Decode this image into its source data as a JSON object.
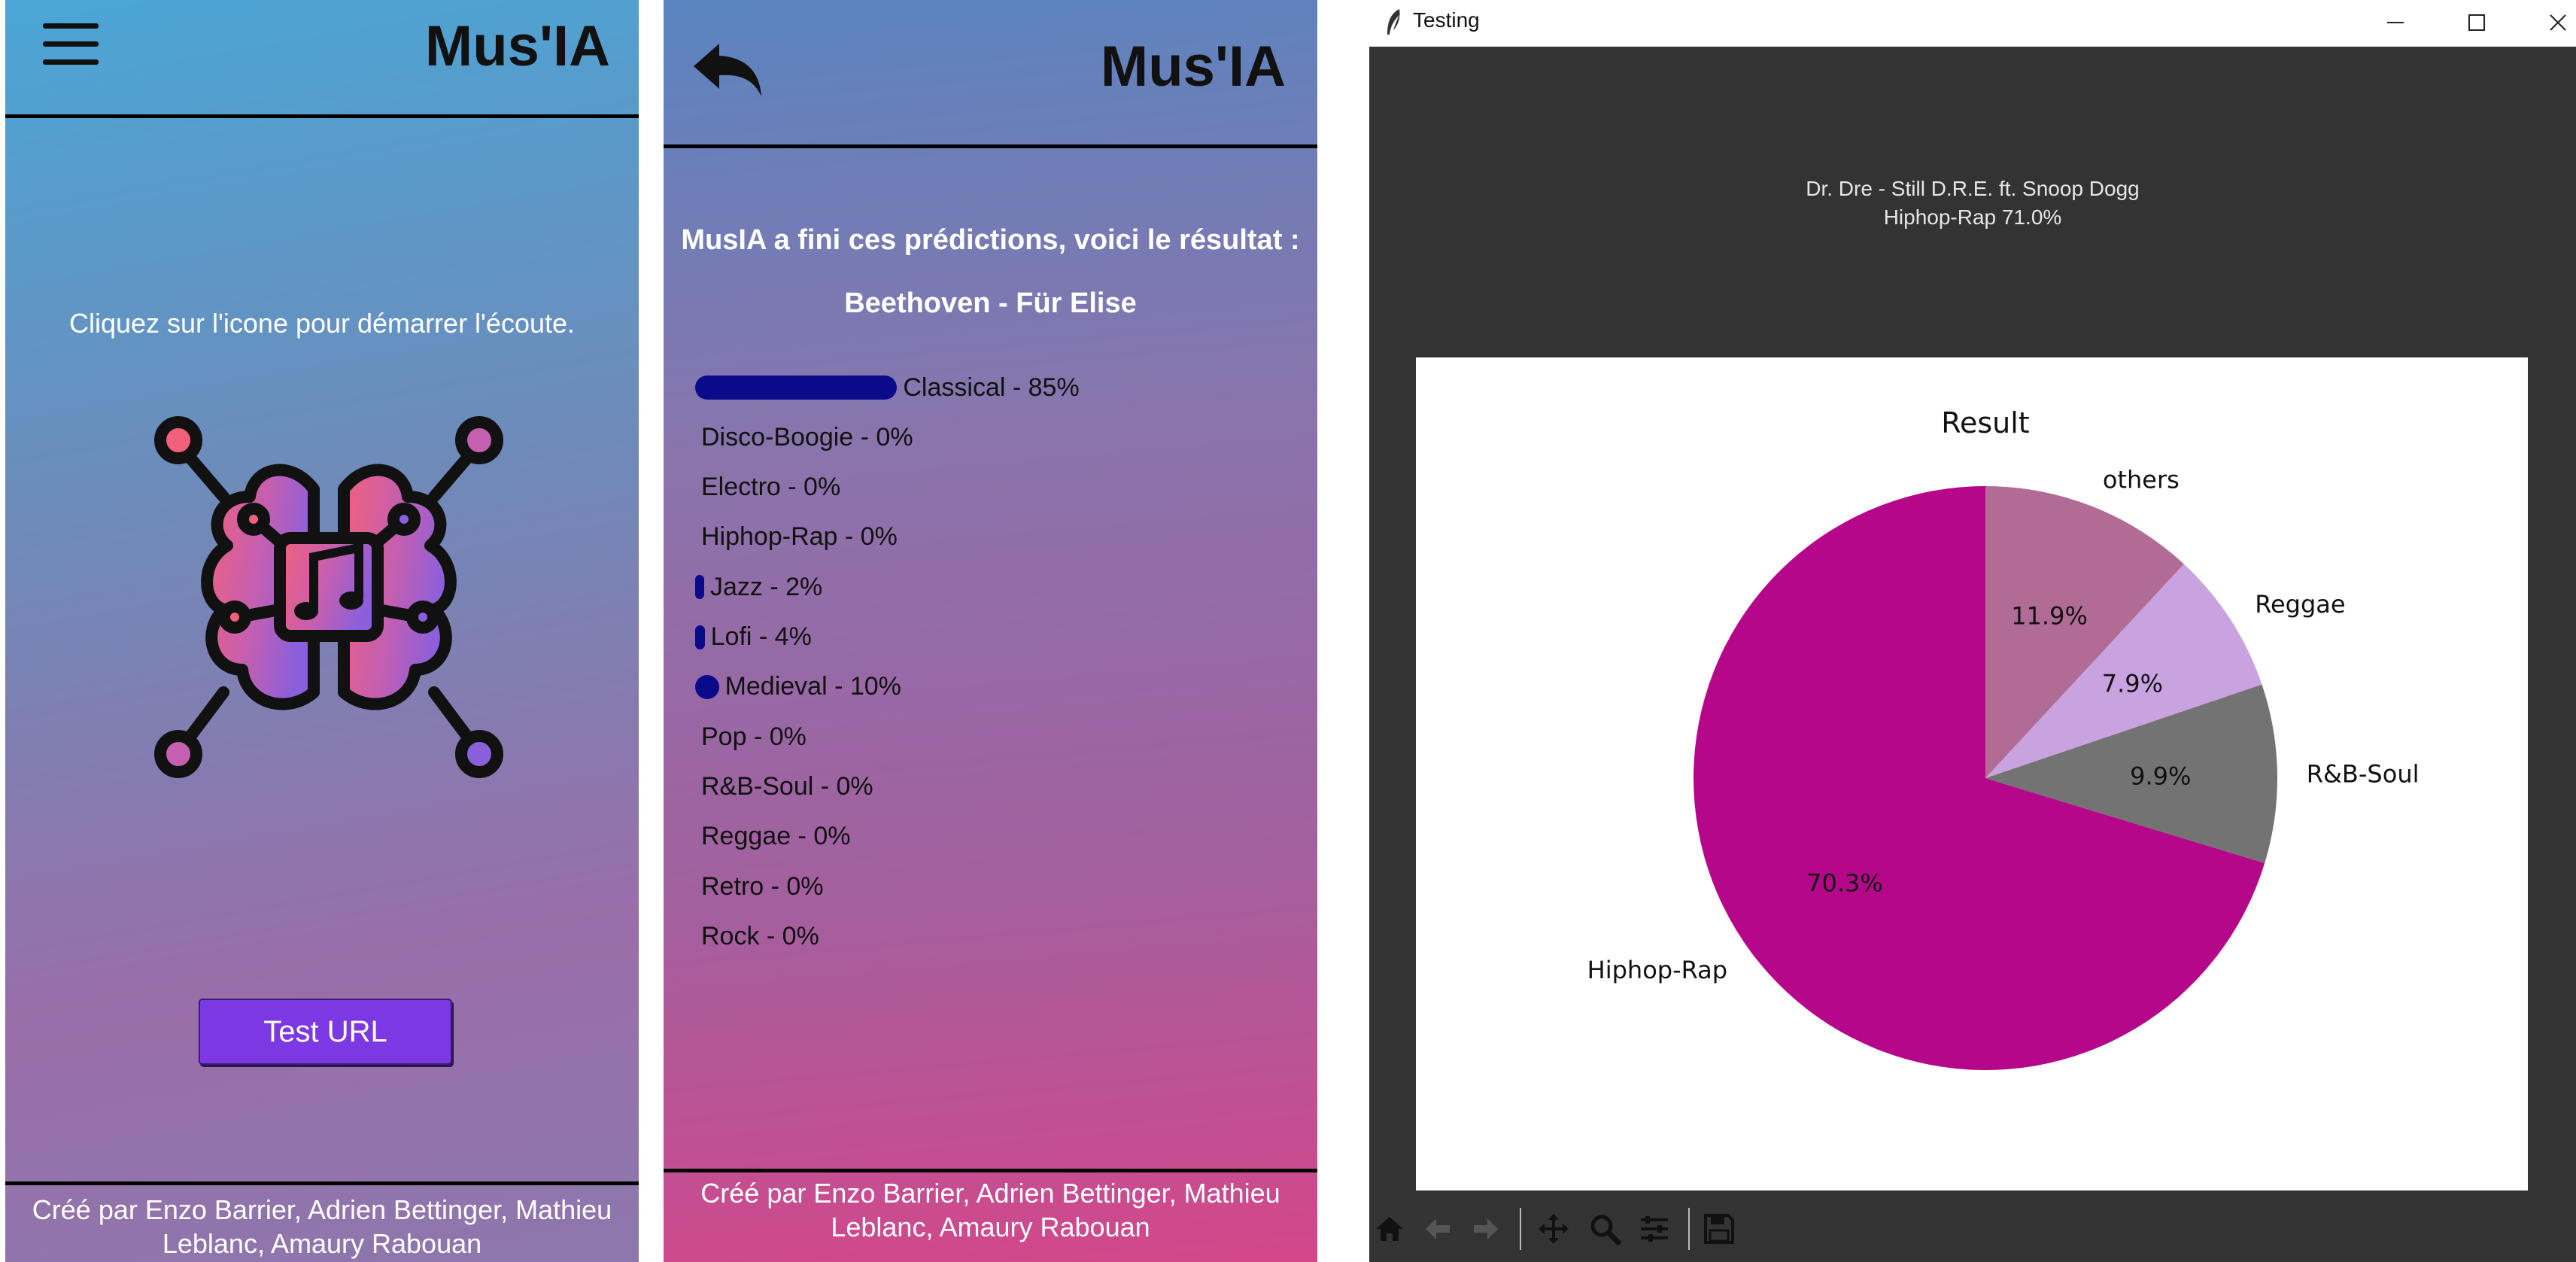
{
  "app1": {
    "title": "Mus'IA",
    "instruction": "Cliquez sur l'icone pour démarrer l'écoute.",
    "button_label": "Test URL",
    "footer": "Créé par Enzo Barrier, Adrien Bettinger, Mathieu Leblanc, Amaury Rabouan"
  },
  "app2": {
    "title": "Mus'IA",
    "result_heading": "MusIA a fini ces prédictions, voici le résultat :",
    "song": "Beethoven - Für Elise",
    "predictions": [
      {
        "genre": "Classical - 85%",
        "value": 85
      },
      {
        "genre": "Disco-Boogie - 0%",
        "value": 0
      },
      {
        "genre": "Electro - 0%",
        "value": 0
      },
      {
        "genre": "Hiphop-Rap - 0%",
        "value": 0
      },
      {
        "genre": "Jazz - 2%",
        "value": 2
      },
      {
        "genre": "Lofi - 4%",
        "value": 4
      },
      {
        "genre": "Medieval - 10%",
        "value": 10
      },
      {
        "genre": "Pop - 0%",
        "value": 0
      },
      {
        "genre": "R&B-Soul - 0%",
        "value": 0
      },
      {
        "genre": "Reggae - 0%",
        "value": 0
      },
      {
        "genre": "Retro - 0%",
        "value": 0
      },
      {
        "genre": "Rock - 0%",
        "value": 0
      }
    ],
    "footer": "Créé par Enzo Barrier, Adrien Bettinger, Mathieu Leblanc, Amaury Rabouan"
  },
  "window": {
    "title": "Testing",
    "song_line": "Dr. Dre - Still D.R.E. ft. Snoop Dogg",
    "result_line": "Hiphop-Rap 71.0%",
    "toolbar_icons": [
      "home-icon",
      "back-arrow-icon",
      "forward-arrow-icon",
      "pan-icon",
      "zoom-icon",
      "configure-subplots-icon",
      "save-icon"
    ]
  },
  "chart_data": {
    "type": "pie",
    "title": "Result",
    "labels": [
      "Hiphop-Rap",
      "R&B-Soul",
      "Reggae",
      "others"
    ],
    "values": [
      70.3,
      9.9,
      7.9,
      11.9
    ],
    "value_labels": [
      "70.3%",
      "9.9%",
      "7.9%",
      "11.9%"
    ],
    "colors": [
      "#b5078a",
      "#737373",
      "#c9a3df",
      "#b16c96"
    ],
    "start_angle_deg": 90,
    "direction": "counterclockwise"
  },
  "colors": {
    "button": "#7b38e3",
    "prediction_bar": "#0a0a8a",
    "window_bg": "#333333"
  }
}
